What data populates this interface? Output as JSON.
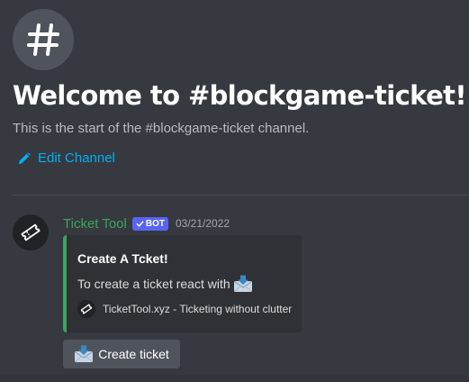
{
  "channel": {
    "hash_glyph": "#",
    "welcome_title": "Welcome to #blockgame-ticket!",
    "welcome_subtitle": "This is the start of the #blockgame-ticket channel.",
    "edit_label": "Edit Channel",
    "icons": [
      "hash-icon",
      "pencil-icon"
    ]
  },
  "message": {
    "author": "Ticket Tool",
    "bot_tag": "BOT",
    "timestamp": "03/21/2022",
    "avatar_icon": "ticket-icon",
    "embed": {
      "accent_color": "#3ba55d",
      "title": "Create A Tcket!",
      "description": "To create a ticket react with",
      "description_icon": "envelope-with-arrow-icon",
      "footer_text": "TicketTool.xyz - Ticketing without clutter",
      "footer_icon": "ticket-icon"
    },
    "button": {
      "label": "Create ticket",
      "icon": "envelope-with-arrow-icon"
    }
  },
  "colors": {
    "background": "#36393f",
    "username": "#3ba55d",
    "link": "#00aff4",
    "bot_tag": "#5865f2",
    "embed_bg": "#2f3136",
    "button_bg": "#4f545c"
  }
}
